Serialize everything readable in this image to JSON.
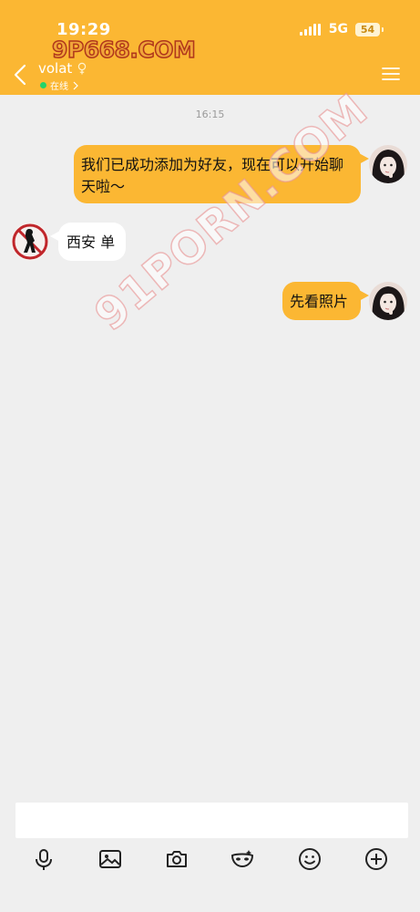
{
  "status_bar": {
    "time": "19:29",
    "network": "5G",
    "battery": "54"
  },
  "watermarks": {
    "top": "9P668.COM",
    "diagonal": "91PORN.COM"
  },
  "header": {
    "contact_name": "volat",
    "online_label": "在线"
  },
  "chat": {
    "timestamp": "16:15",
    "messages": [
      {
        "direction": "out",
        "text": "我们已成功添加为好友，现在可以开始聊天啦～"
      },
      {
        "direction": "in",
        "text": "西安 单"
      },
      {
        "direction": "out",
        "text": "先看照片"
      }
    ]
  },
  "input": {
    "placeholder": ""
  },
  "toolbar": {
    "tools": [
      "microphone-icon",
      "image-icon",
      "camera-icon",
      "mask-icon",
      "emoji-icon",
      "plus-icon"
    ]
  },
  "colors": {
    "header_bg": "#fbb733",
    "outgoing_bubble": "#fbb733",
    "incoming_bubble": "#ffffff",
    "page_bg": "#efefef",
    "online_dot": "#22d36a"
  }
}
